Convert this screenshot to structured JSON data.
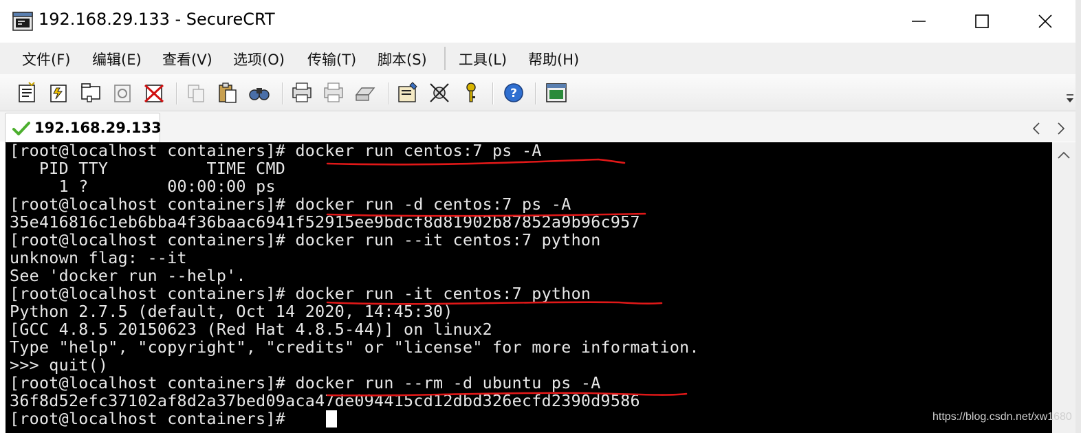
{
  "window": {
    "title": "192.168.29.133 - SecureCRT"
  },
  "menu": {
    "items": [
      "文件(F)",
      "编辑(E)",
      "查看(V)",
      "选项(O)",
      "传输(T)",
      "脚本(S)",
      "工具(L)",
      "帮助(H)"
    ]
  },
  "toolbar": {
    "icons": [
      "connect-icon",
      "quick-connect-icon",
      "connect-in-tab-icon",
      "reconnect-icon",
      "disconnect-icon",
      "copy-icon",
      "paste-icon",
      "find-icon",
      "print-icon",
      "print-selection-icon",
      "print-setup-icon",
      "session-options-icon",
      "global-options-icon",
      "key-icon",
      "help-icon",
      "about-icon"
    ]
  },
  "tab": {
    "label": "192.168.29.133",
    "status": "connected"
  },
  "terminal": {
    "lines": [
      "[root@localhost containers]# docker run centos:7 ps -A",
      "   PID TTY          TIME CMD",
      "     1 ?        00:00:00 ps",
      "[root@localhost containers]# docker run -d centos:7 ps -A",
      "35e416816c1eb6bba4f36baac6941f52915ee9bdcf8d81902b87852a9b96c957",
      "[root@localhost containers]# docker run --it centos:7 python",
      "unknown flag: --it",
      "See 'docker run --help'.",
      "[root@localhost containers]# docker run -it centos:7 python",
      "Python 2.7.5 (default, Oct 14 2020, 14:45:30)",
      "[GCC 4.8.5 20150623 (Red Hat 4.8.5-44)] on linux2",
      "Type \"help\", \"copyright\", \"credits\" or \"license\" for more information.",
      ">>> quit()",
      "[root@localhost containers]# docker run --rm -d ubuntu ps -A",
      "36f8d52efc37102af8d2a37bed09aca47de094415cd12dbd326ecfd2390d9586",
      "[root@localhost containers]# "
    ]
  },
  "colors": {
    "terminal_bg": "#000000",
    "terminal_fg": "#e8e8e8",
    "annotation": "#e01818",
    "tab_check": "#4caf2e"
  },
  "watermark": "https://blog.csdn.net/xw1680"
}
